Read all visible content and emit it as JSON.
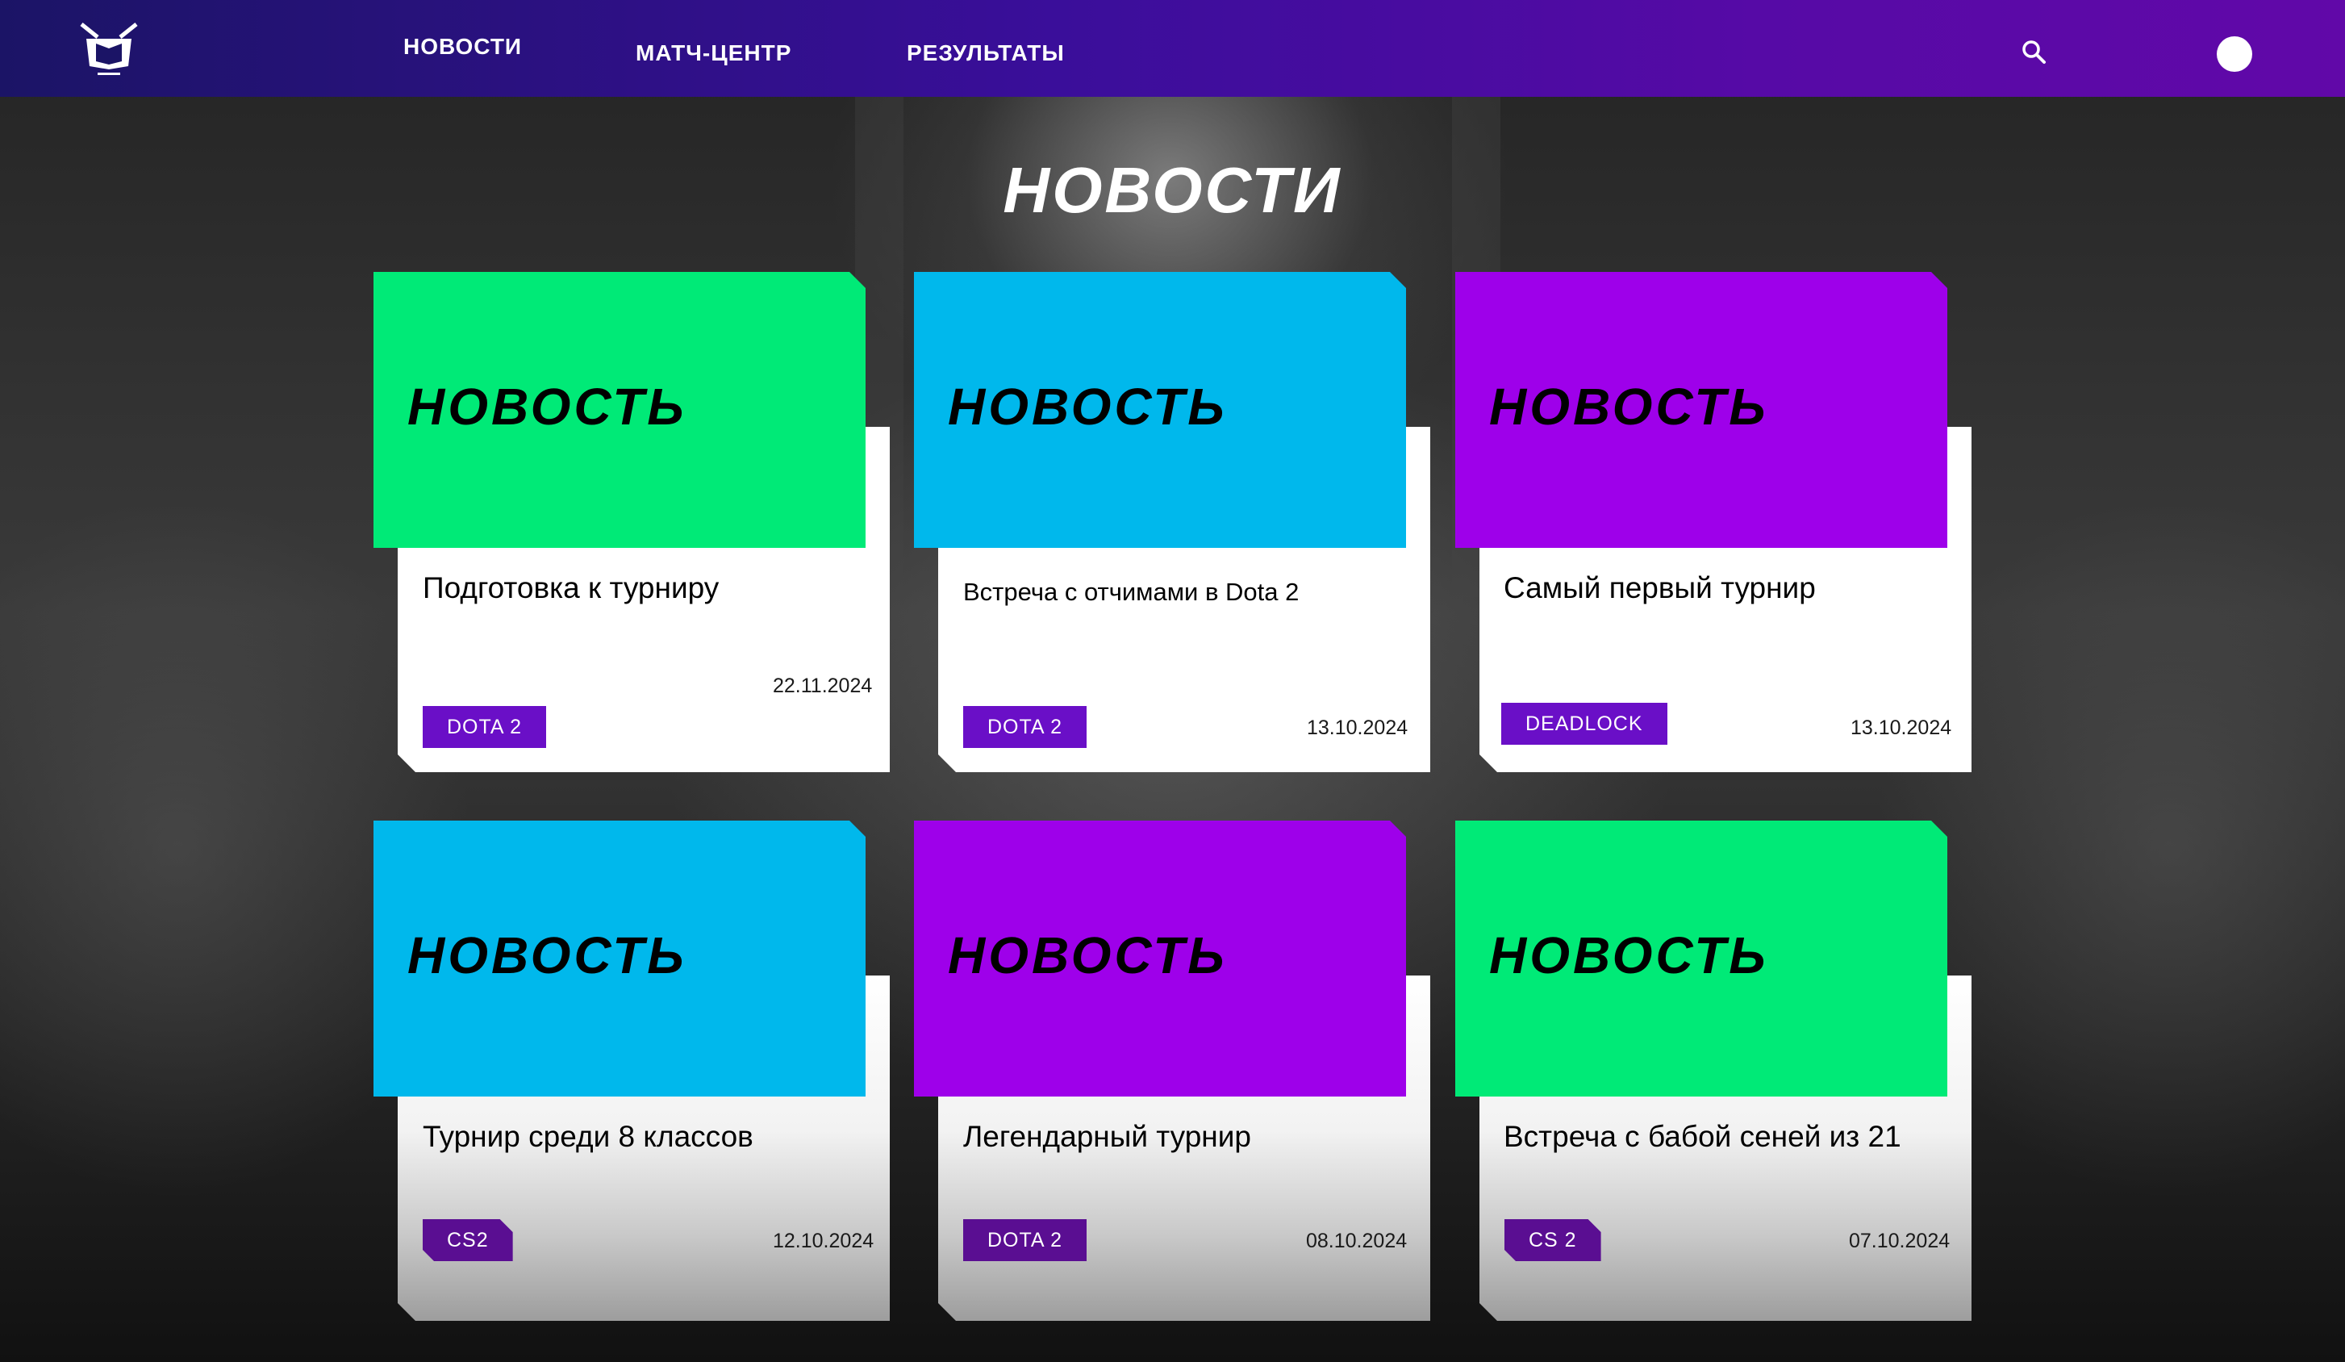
{
  "colors": {
    "header_gradient": [
      "#1b1466",
      "#6108a8"
    ],
    "green": "#00ea77",
    "blue": "#00b8ec",
    "purple": "#9e00ea",
    "tag": "#6a0fc7"
  },
  "header": {
    "logo_icon": "tv-crown-logo",
    "nav": [
      {
        "label": "НОВОСТИ"
      },
      {
        "label": "МАТЧ-ЦЕНТР"
      },
      {
        "label": "РЕЗУЛЬТАТЫ"
      }
    ],
    "search_icon": "search-icon",
    "avatar": "avatar"
  },
  "page_title": "НОВОСТИ",
  "cards": [
    {
      "banner": "НОВОСТЬ",
      "banner_color": "#00ea77",
      "title": "Подготовка к турниру",
      "date": "22.11.2024",
      "tag": "DOTA 2"
    },
    {
      "banner": "НОВОСТЬ",
      "banner_color": "#00b8ec",
      "title": "Встреча с отчимами в Dota 2",
      "date": "13.10.2024",
      "tag": "DOTA 2"
    },
    {
      "banner": "НОВОСТЬ",
      "banner_color": "#9e00ea",
      "title": "Самый первый турнир",
      "date": "13.10.2024",
      "tag": "DEADLOCK"
    },
    {
      "banner": "НОВОСТЬ",
      "banner_color": "#00b8ec",
      "title": "Турнир среди 8 классов",
      "date": "12.10.2024",
      "tag": "CS2"
    },
    {
      "banner": "НОВОСТЬ",
      "banner_color": "#9e00ea",
      "title": "Легендарный турнир",
      "date": "08.10.2024",
      "tag": "DOTA 2"
    },
    {
      "banner": "НОВОСТЬ",
      "banner_color": "#00ea77",
      "title": "Встреча с бабой сеней из 21",
      "date": "07.10.2024",
      "tag": "CS 2"
    }
  ]
}
